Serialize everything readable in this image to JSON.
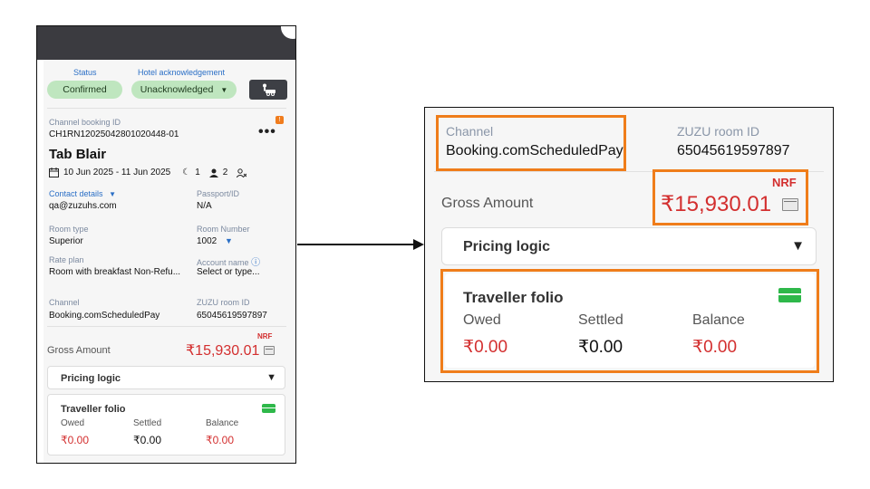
{
  "left": {
    "status_label": "Status",
    "status_value": "Confirmed",
    "ack_label": "Hotel acknowledgement",
    "ack_value": "Unacknowledged",
    "channel_booking_label": "Channel booking ID",
    "channel_booking_value": "CH1RN12025042801020448-01",
    "more_icon": "•••",
    "guest_name": "Tab Blair",
    "dates": "10 Jun 2025 - 11 Jun 2025",
    "nights": "1",
    "guests": "2",
    "contact_label": "Contact details",
    "contact_value": "qa@zuzuhs.com",
    "passport_label": "Passport/ID",
    "passport_value": "N/A",
    "room_type_label": "Room type",
    "room_type_value": "Superior",
    "room_number_label": "Room Number",
    "room_number_value": "1002",
    "rate_plan_label": "Rate plan",
    "rate_plan_value": "Room with breakfast Non-Refu...",
    "account_label": "Account name",
    "account_value": "Select or type...",
    "channel_label": "Channel",
    "channel_value": "Booking.comScheduledPay",
    "zuzu_room_label": "ZUZU room ID",
    "zuzu_room_value": "65045619597897",
    "nrf": "NRF",
    "gross_label": "Gross Amount",
    "gross_value": "₹15,930.01",
    "pricing_logic": "Pricing logic",
    "folio_title": "Traveller folio",
    "owed_label": "Owed",
    "owed_value": "₹0.00",
    "settled_label": "Settled",
    "settled_value": "₹0.00",
    "balance_label": "Balance",
    "balance_value": "₹0.00"
  },
  "right": {
    "channel_label": "Channel",
    "channel_value": "Booking.comScheduledPay",
    "zuzu_room_label": "ZUZU room ID",
    "zuzu_room_value": "65045619597897",
    "nrf": "NRF",
    "gross_label": "Gross Amount",
    "gross_value": "₹15,930.01",
    "pricing_logic": "Pricing logic",
    "folio_title": "Traveller folio",
    "owed_label": "Owed",
    "owed_value": "₹0.00",
    "settled_label": "Settled",
    "settled_value": "₹0.00",
    "balance_label": "Balance",
    "balance_value": "₹0.00"
  },
  "icons": {
    "dropdown": "▼",
    "caret": "▾",
    "calendar": "calendar-icon",
    "moon": "☾",
    "person": "person-icon",
    "info": "ⓘ",
    "card": "credit-card-icon",
    "car": "car-icon"
  },
  "colors": {
    "highlight": "#ef7d1a",
    "amount_red": "#d32f2f",
    "status_green": "#bfe6bf",
    "card_green": "#2eb84a",
    "header_dark": "#3b3b40"
  }
}
